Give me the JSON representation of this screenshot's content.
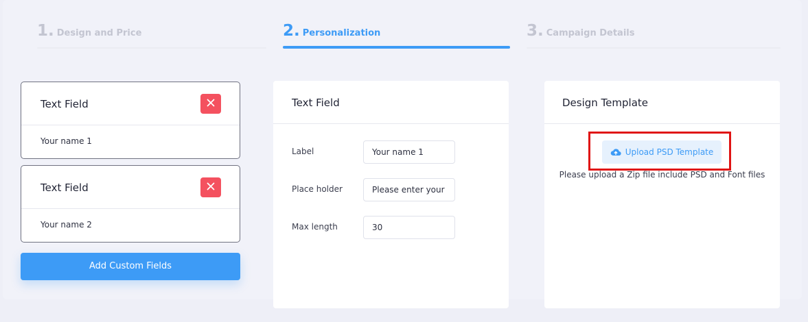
{
  "steps": [
    {
      "number": "1.",
      "label": "Design and Price",
      "state": "inactive"
    },
    {
      "number": "2.",
      "label": "Personalization",
      "state": "active"
    },
    {
      "number": "3.",
      "label": "Campaign Details",
      "state": "inactive"
    }
  ],
  "fields": [
    {
      "title": "Text Field",
      "value": "Your name 1"
    },
    {
      "title": "Text Field",
      "value": "Your name 2"
    }
  ],
  "add_button_label": "Add Custom Fields",
  "editor": {
    "title": "Text Field",
    "rows": [
      {
        "label": "Label",
        "value": "Your name 1"
      },
      {
        "label": "Place holder",
        "value": "Please enter your name"
      },
      {
        "label": "Max length",
        "value": "30"
      }
    ]
  },
  "template": {
    "title": "Design Template",
    "upload_label": "Upload PSD Template",
    "hint": "Please upload a Zip file include PSD and Font files"
  },
  "colors": {
    "accent": "#3d9bf6",
    "danger": "#f4515f",
    "highlight": "#e01414",
    "background": "#eeeff7"
  },
  "icons": {
    "close": "close-icon",
    "upload": "cloud-upload-icon"
  }
}
